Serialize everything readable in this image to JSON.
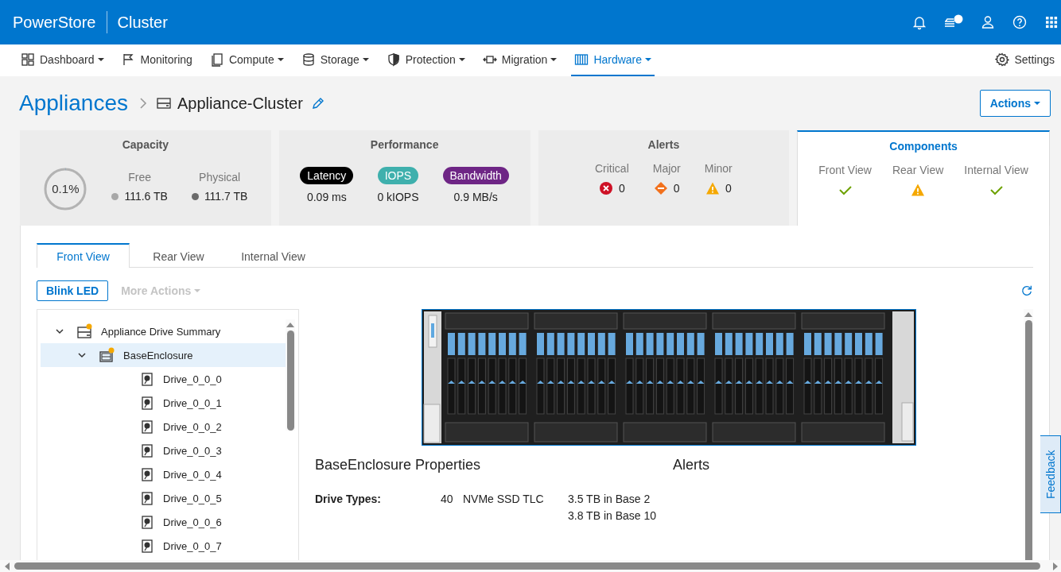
{
  "header": {
    "brand": "PowerStore",
    "context": "Cluster",
    "notification_badge": true
  },
  "nav": [
    {
      "label": "Dashboard",
      "dropdown": true,
      "selected": false
    },
    {
      "label": "Monitoring",
      "dropdown": false,
      "selected": false
    },
    {
      "label": "Compute",
      "dropdown": true,
      "selected": false
    },
    {
      "label": "Storage",
      "dropdown": true,
      "selected": false
    },
    {
      "label": "Protection",
      "dropdown": true,
      "selected": false
    },
    {
      "label": "Migration",
      "dropdown": true,
      "selected": false
    },
    {
      "label": "Hardware",
      "dropdown": true,
      "selected": true
    }
  ],
  "settings": "Settings",
  "breadcrumb": {
    "parent": "Appliances",
    "current": "Appliance-Cluster"
  },
  "actions_button": "Actions",
  "cards": [
    {
      "kind": "capacity",
      "title": "Capacity",
      "selected": false,
      "gauge": "0.1%",
      "level": 0.001,
      "items": [
        {
          "label": "Free",
          "value": "111.6 TB",
          "color": "#a8a8a8"
        },
        {
          "label": "Physical",
          "value": "111.7 TB",
          "color": "#6b6b6b"
        }
      ]
    },
    {
      "kind": "performance",
      "title": "Performance",
      "selected": false,
      "items": [
        {
          "label": "Latency",
          "value": "0.09 ms",
          "color": "#000000"
        },
        {
          "label": "IOPS",
          "value": "0 kIOPS",
          "color": "#3fb0ad"
        },
        {
          "label": "Bandwidth",
          "value": "0.9 MB/s",
          "color": "#6e2585"
        }
      ]
    },
    {
      "kind": "alerts",
      "title": "Alerts",
      "selected": false,
      "items": [
        {
          "label": "Critical",
          "kind": "critical",
          "value": "0"
        },
        {
          "label": "Major",
          "kind": "major",
          "value": "0"
        },
        {
          "label": "Minor",
          "kind": "minor",
          "value": "0"
        }
      ]
    },
    {
      "kind": "components",
      "title": "Components",
      "selected": true,
      "items": [
        {
          "label": "Front View",
          "kind": "ok"
        },
        {
          "label": "Rear View",
          "kind": "warning"
        },
        {
          "label": "Internal View",
          "kind": "ok"
        }
      ]
    }
  ],
  "tabs": [
    {
      "label": "Front View",
      "selected": true
    },
    {
      "label": "Rear View",
      "selected": false
    },
    {
      "label": "Internal View",
      "selected": false
    }
  ],
  "toolbar": {
    "blink": "Blink LED",
    "more": {
      "label": "More Actions",
      "disabled": true
    }
  },
  "tree": [
    {
      "label": "Appliance Drive Summary",
      "kind": "summary",
      "alert": true,
      "expanded": true,
      "selected": false,
      "children": [
        {
          "label": "BaseEnclosure",
          "kind": "enclosure",
          "alert": true,
          "expanded": true,
          "selected": true,
          "children": [
            {
              "label": "Drive_0_0_0",
              "kind": "drive",
              "alert": false,
              "selected": false
            },
            {
              "label": "Drive_0_0_1",
              "kind": "drive",
              "alert": false,
              "selected": false
            },
            {
              "label": "Drive_0_0_2",
              "kind": "drive",
              "alert": false,
              "selected": false
            },
            {
              "label": "Drive_0_0_3",
              "kind": "drive",
              "alert": false,
              "selected": false
            },
            {
              "label": "Drive_0_0_4",
              "kind": "drive",
              "alert": false,
              "selected": false
            },
            {
              "label": "Drive_0_0_5",
              "kind": "drive",
              "alert": false,
              "selected": false
            },
            {
              "label": "Drive_0_0_6",
              "kind": "drive",
              "alert": false,
              "selected": false
            },
            {
              "label": "Drive_0_0_7",
              "kind": "drive",
              "alert": false,
              "selected": false
            }
          ]
        }
      ]
    }
  ],
  "properties": {
    "title": "BaseEnclosure Properties",
    "rows": [
      {
        "label": "Drive Types:",
        "count": "40",
        "type": "NVMe SSD TLC",
        "details": [
          "3.5 TB in Base 2",
          "3.8 TB in Base 10"
        ]
      }
    ]
  },
  "alerts_heading": "Alerts",
  "feedback": "Feedback"
}
